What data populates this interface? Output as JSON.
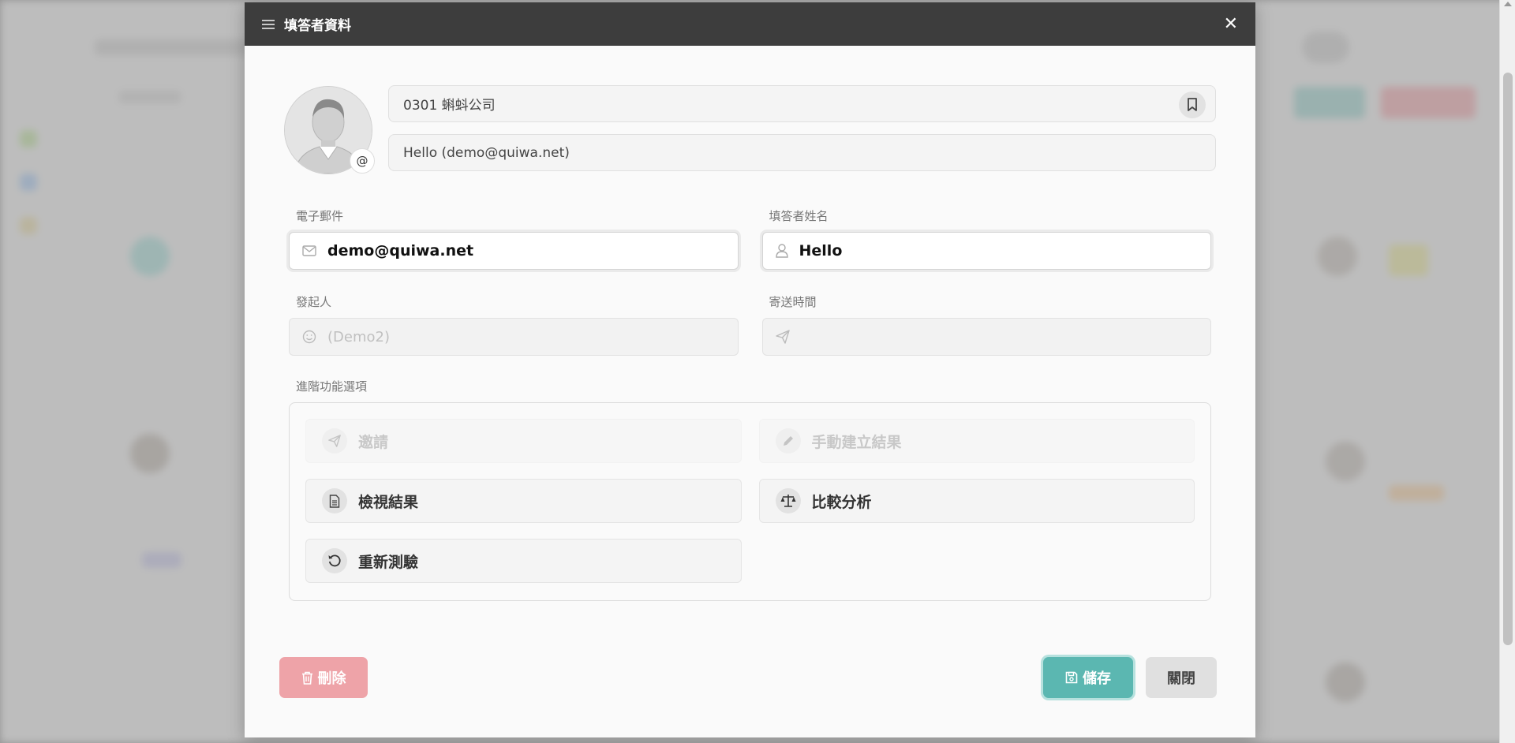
{
  "modal": {
    "title": "填答者資料"
  },
  "profile": {
    "group": "0301 蝌蚪公司",
    "display": "Hello (demo@quiwa.net)",
    "avatar_badge": "@"
  },
  "fields": {
    "email_label": "電子郵件",
    "email_value": "demo@quiwa.net",
    "name_label": "填答者姓名",
    "name_value": "Hello",
    "initiator_label": "發起人",
    "initiator_value": "(Demo2)",
    "send_time_label": "寄送時間",
    "send_time_value": ""
  },
  "advanced": {
    "label": "進階功能選項",
    "invite": "邀請",
    "manual_result": "手動建立結果",
    "view_result": "檢視結果",
    "compare": "比較分析",
    "retest": "重新測驗"
  },
  "footer": {
    "delete_label": "刪除",
    "save_label": "儲存",
    "close_label": "關閉"
  },
  "colors": {
    "header_bg": "#3d3d3d",
    "save": "#5bb7b1",
    "delete": "#eea3a8"
  }
}
